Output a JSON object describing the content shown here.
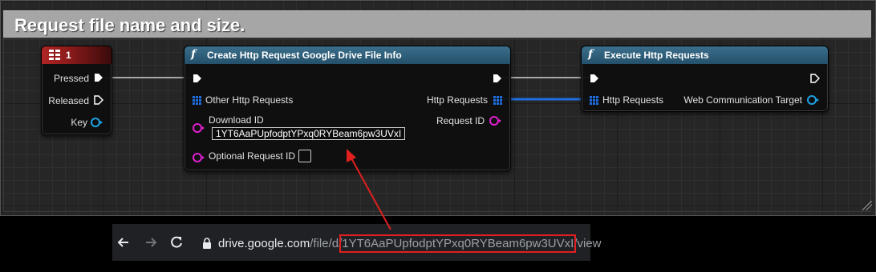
{
  "comment": {
    "title": "Request file name and size."
  },
  "key_event_node": {
    "title": "1",
    "pins": {
      "pressed": "Pressed",
      "released": "Released",
      "key": "Key"
    }
  },
  "create_request_node": {
    "title": "Create Http Request Google Drive File Info",
    "pins": {
      "other_requests": "Other Http Requests",
      "download_id_label": "Download ID",
      "download_id_value": "1YT6AaPUpfodptYPxq0RYBeam6pw3UVxI",
      "optional_request_id": "Optional Request ID",
      "http_requests_out": "Http Requests",
      "request_id_out": "Request ID"
    }
  },
  "execute_node": {
    "title": "Execute Http Requests",
    "pins": {
      "http_requests_in": "Http Requests",
      "web_comm_target": "Web Communication Target"
    }
  },
  "browser": {
    "back_icon": "arrow-left-icon",
    "forward_icon": "arrow-right-icon",
    "reload_icon": "reload-icon",
    "url_host": "drive.google.com",
    "url_path_prefix": "/file/d/",
    "url_file_id": "1YT6AaPUpfodptYPxq0RYBeam6pw3UVxI",
    "url_path_suffix": "/view"
  },
  "colors": {
    "exec_wire": "#b0b0b0",
    "array_wire": "#1f6fe0",
    "annotation_red": "#e02020",
    "object_pin": "#1fa2e6",
    "string_pin": "#e01fd0"
  }
}
